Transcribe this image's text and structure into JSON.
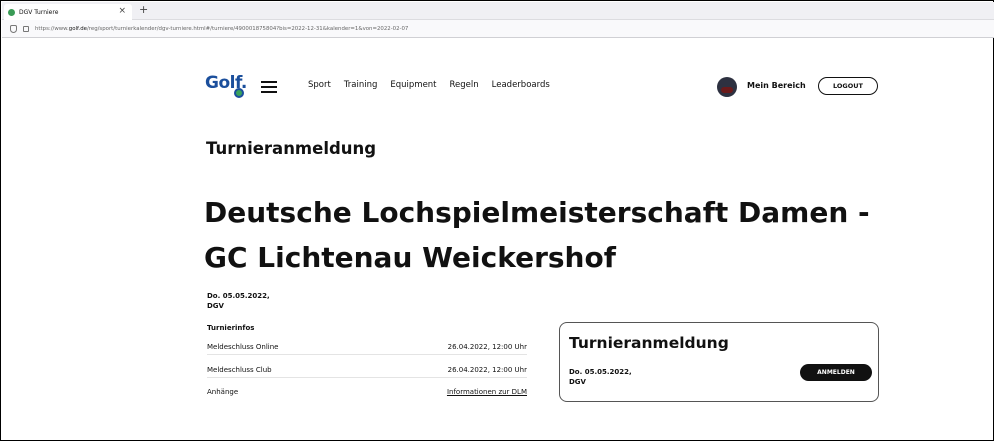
{
  "browser": {
    "tab_title": "DGV Turniere",
    "tab_close": "×",
    "new_tab": "+",
    "url_prefix": "https://www.",
    "url_host": "golf.de",
    "url_path": "/reg/sport/turnierkalender/dgv-turniere.html#/turniere/490001875804?bis=2022-12-31&kalender=1&von=2022-02-07"
  },
  "site": {
    "logo_text": "Golf.",
    "nav": [
      "Sport",
      "Training",
      "Equipment",
      "Regeln",
      "Leaderboards"
    ],
    "my_area": "Mein Bereich",
    "logout": "LOGOUT"
  },
  "page": {
    "subtitle": "Turnieranmeldung",
    "title": "Deutsche Lochspielmeisterschaft Damen - GC Lichtenau Weickershof",
    "date_line1": "Do. 05.05.2022,",
    "date_line2": "DGV",
    "info_heading": "Turnierinfos",
    "info_rows": [
      {
        "label": "Meldeschluss Online",
        "value": "26.04.2022, 12:00 Uhr"
      },
      {
        "label": "Meldeschluss Club",
        "value": "26.04.2022, 12:00 Uhr"
      },
      {
        "label": "Anhänge",
        "value": "Informationen zur DLM"
      }
    ]
  },
  "card": {
    "title": "Turnieranmeldung",
    "date_line1": "Do. 05.05.2022,",
    "date_line2": "DGV",
    "button": "ANMELDEN"
  }
}
